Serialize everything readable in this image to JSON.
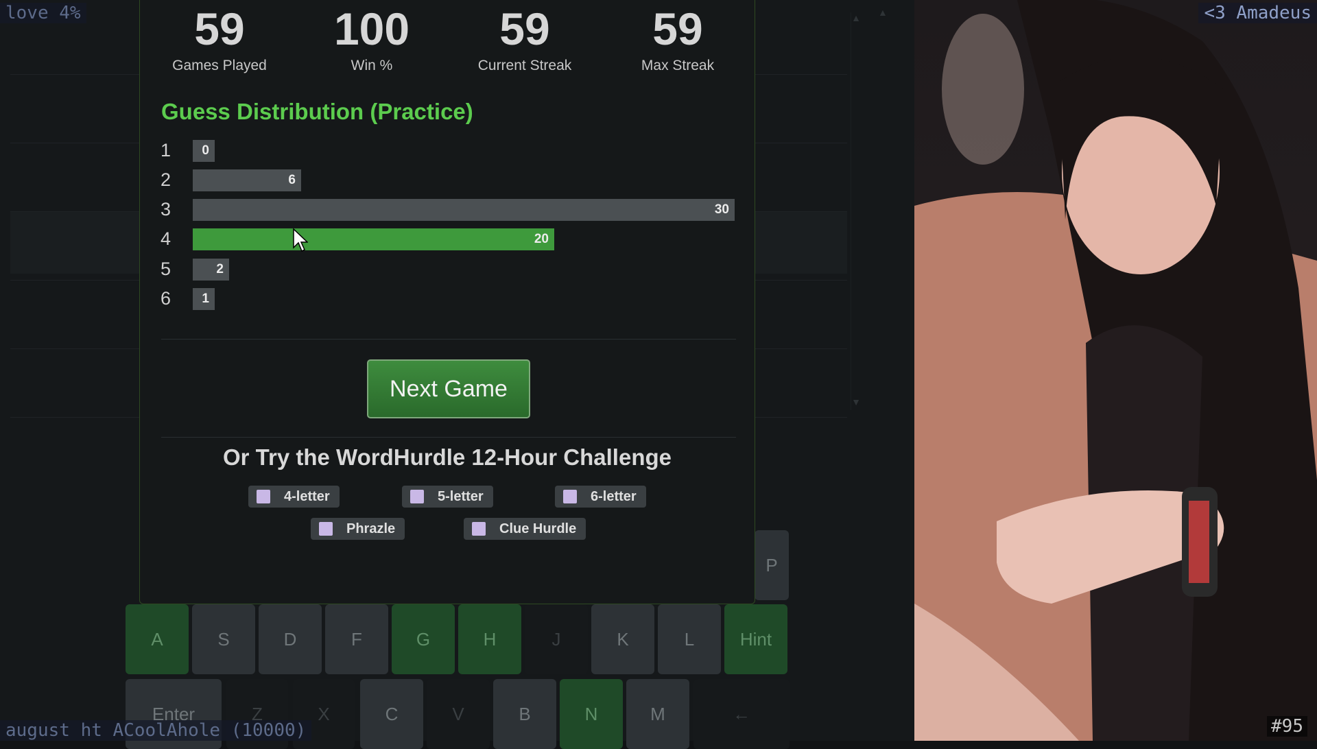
{
  "stats": [
    {
      "value": "59",
      "label": "Games Played"
    },
    {
      "value": "100",
      "label": "Win %"
    },
    {
      "value": "59",
      "label": "Current Streak"
    },
    {
      "value": "59",
      "label": "Max Streak"
    }
  ],
  "distribution": {
    "title": "Guess Distribution (Practice)",
    "max": 30,
    "rows": [
      {
        "guess": "1",
        "count": "0",
        "value": 0,
        "current": false
      },
      {
        "guess": "2",
        "count": "6",
        "value": 6,
        "current": false
      },
      {
        "guess": "3",
        "count": "30",
        "value": 30,
        "current": false
      },
      {
        "guess": "4",
        "count": "20",
        "value": 20,
        "current": true
      },
      {
        "guess": "5",
        "count": "2",
        "value": 2,
        "current": false
      },
      {
        "guess": "6",
        "count": "1",
        "value": 1,
        "current": false
      }
    ]
  },
  "next_game_label": "Next Game",
  "challenge": {
    "title": "Or Try the WordHurdle 12-Hour Challenge",
    "options": [
      "4-letter",
      "5-letter",
      "6-letter",
      "Phrazle",
      "Clue Hurdle"
    ]
  },
  "keyboard": {
    "row_middle": [
      {
        "key": "A",
        "state": "green"
      },
      {
        "key": "S",
        "state": "gray"
      },
      {
        "key": "D",
        "state": "gray"
      },
      {
        "key": "F",
        "state": "gray"
      },
      {
        "key": "G",
        "state": "green"
      },
      {
        "key": "H",
        "state": "green"
      },
      {
        "key": "J",
        "state": "dark"
      },
      {
        "key": "K",
        "state": "gray"
      },
      {
        "key": "L",
        "state": "gray"
      },
      {
        "key": "Hint",
        "state": "green"
      }
    ],
    "row_bottom": [
      {
        "key": "Enter",
        "state": "gray"
      },
      {
        "key": "Z",
        "state": "dark"
      },
      {
        "key": "X",
        "state": "dark"
      },
      {
        "key": "C",
        "state": "gray"
      },
      {
        "key": "V",
        "state": "dark"
      },
      {
        "key": "B",
        "state": "gray"
      },
      {
        "key": "N",
        "state": "green"
      },
      {
        "key": "M",
        "state": "gray"
      },
      {
        "key": "←",
        "state": "dark"
      }
    ],
    "partial_top_key": "P"
  },
  "overlays": {
    "top_left": "love 4%",
    "top_right": "<3 Amadeus",
    "bottom_left": "august ht ACoolAhole (10000)",
    "bottom_right": "#95"
  }
}
